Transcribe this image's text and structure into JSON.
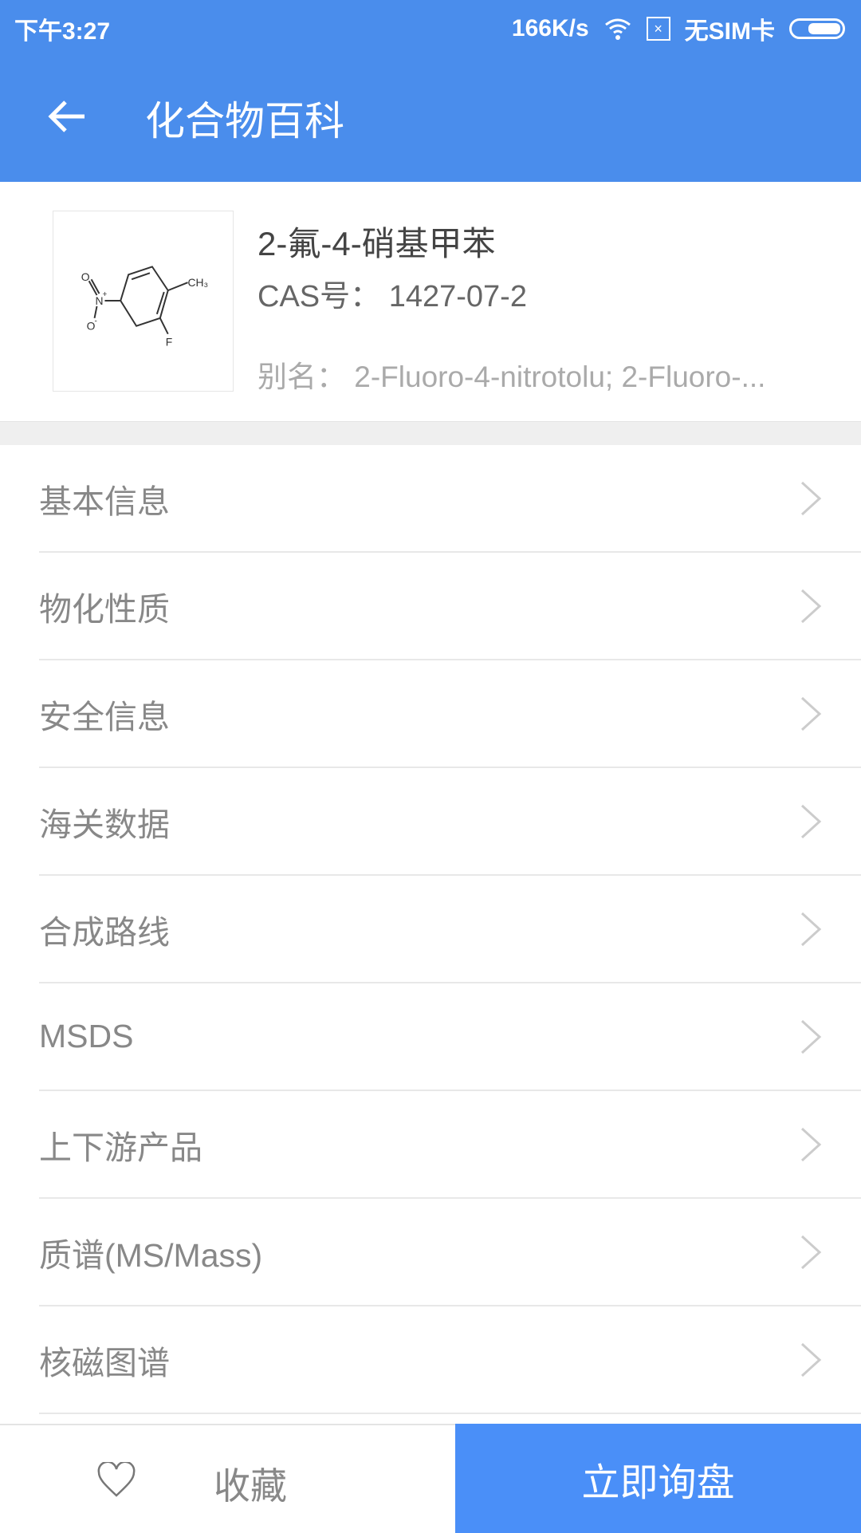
{
  "status_bar": {
    "time": "下午3:27",
    "speed": "166K/s",
    "sim": "无SIM卡"
  },
  "header": {
    "title": "化合物百科"
  },
  "compound": {
    "name": "2-氟-4-硝基甲苯",
    "cas_label": "CAS号：",
    "cas": "1427-07-2",
    "alias_label": "别名：",
    "alias": "2-Fluoro-4-nitrotolu; 2-Fluoro-..."
  },
  "menu": [
    {
      "label": "基本信息"
    },
    {
      "label": "物化性质"
    },
    {
      "label": "安全信息"
    },
    {
      "label": "海关数据"
    },
    {
      "label": "合成路线"
    },
    {
      "label": "MSDS"
    },
    {
      "label": "上下游产品"
    },
    {
      "label": "质谱(MS/Mass)"
    },
    {
      "label": "核磁图谱"
    }
  ],
  "footer": {
    "favorite": "收藏",
    "inquire": "立即询盘"
  },
  "colors": {
    "header": "#4a8dec",
    "button": "#4a8ff8"
  }
}
